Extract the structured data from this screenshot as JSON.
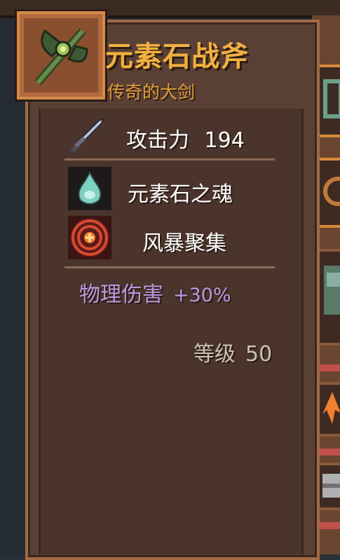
{
  "item": {
    "name": "元素石战斧",
    "subtitle": "传奇的大剑",
    "icon": "axe-icon"
  },
  "stats": {
    "attack_label": "攻击力",
    "attack_value": "194",
    "attack_icon": "sword-icon"
  },
  "skills": [
    {
      "name": "元素石之魂",
      "icon": "soul-orb-icon"
    },
    {
      "name": "风暴聚集",
      "icon": "storm-target-icon"
    }
  ],
  "bonus": {
    "label": "物理伤害",
    "value": "+30%"
  },
  "level": {
    "label": "等级",
    "value": "50"
  },
  "colors": {
    "title": "#f2b040",
    "subtitle": "#e09a3a",
    "bonus": "#b89ae0",
    "panel": "#5a4034"
  }
}
